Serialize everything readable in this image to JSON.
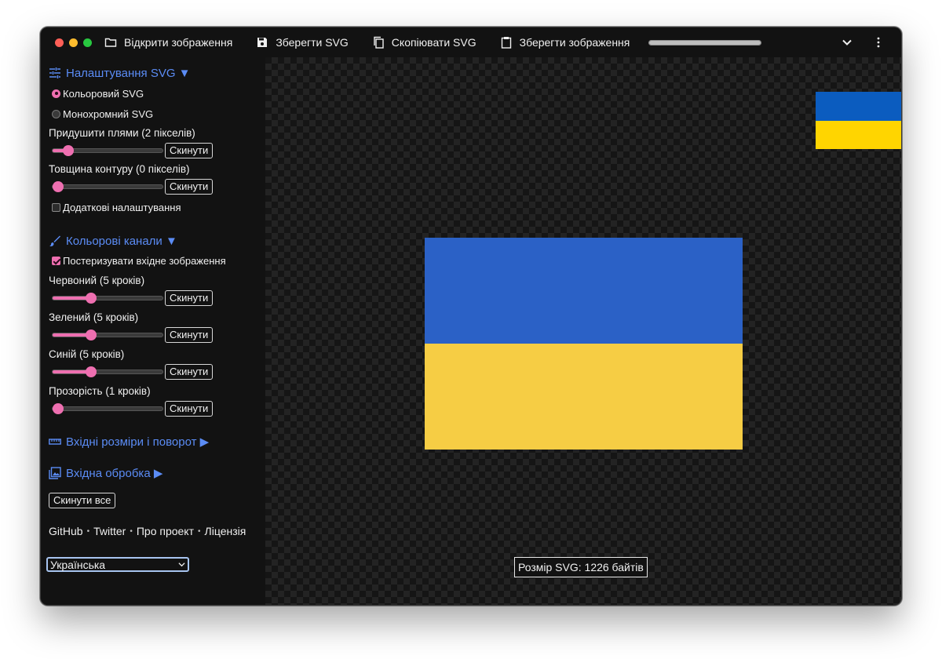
{
  "toolbar": {
    "open_image": "Відкрити зображення",
    "save_svg": "Зберегти SVG",
    "copy_svg": "Скопіювати SVG",
    "save_image": "Зберегти зображення",
    "progress": 1.0
  },
  "svg_settings": {
    "title": "Налаштування SVG ▼",
    "color_svg": "Кольоровий SVG",
    "mono_svg": "Монохромний SVG",
    "selected_mode": "color",
    "suppress_label": "Придушити плями (2 пікселів)",
    "suppress_value": 2,
    "suppress_max": 100,
    "stroke_label": "Товщина контуру (0 пікселів)",
    "stroke_value": 0,
    "stroke_max": 10,
    "advanced_label": "Додаткові налаштування",
    "advanced_checked": false
  },
  "color_channels": {
    "title": "Кольорові канали ▼",
    "posterize_label": "Постеризувати вхідне зображення",
    "posterize_checked": true,
    "red_label": "Червоний (5 кроків)",
    "green_label": "Зелений (5 кроків)",
    "blue_label": "Синій (5 кроків)",
    "alpha_label": "Прозорість (1 кроків)",
    "steps": {
      "red": 5,
      "green": 5,
      "blue": 5,
      "alpha": 1,
      "max": 20
    }
  },
  "input_size": {
    "title": "Вхідні розміри і поворот ▶"
  },
  "input_processing": {
    "title": "Вхідна обробка ▶"
  },
  "reset_label": "Скинути",
  "reset_all_label": "Скинути все",
  "footer": {
    "github": "GitHub",
    "twitter": "Twitter",
    "about": "Про проект",
    "license": "Ліцензія",
    "separator": "•"
  },
  "language": {
    "selected": "Українська"
  },
  "svg_size_text": "Розмір SVG: 1226 байтів",
  "colors": {
    "flag_blue": "#2b61c6",
    "flag_yellow": "#f6cd44",
    "thumb_blue": "#0b5cbf",
    "thumb_yellow": "#ffd500",
    "accent_pink": "#ee6fb0",
    "link_blue": "#5b8cf5"
  }
}
